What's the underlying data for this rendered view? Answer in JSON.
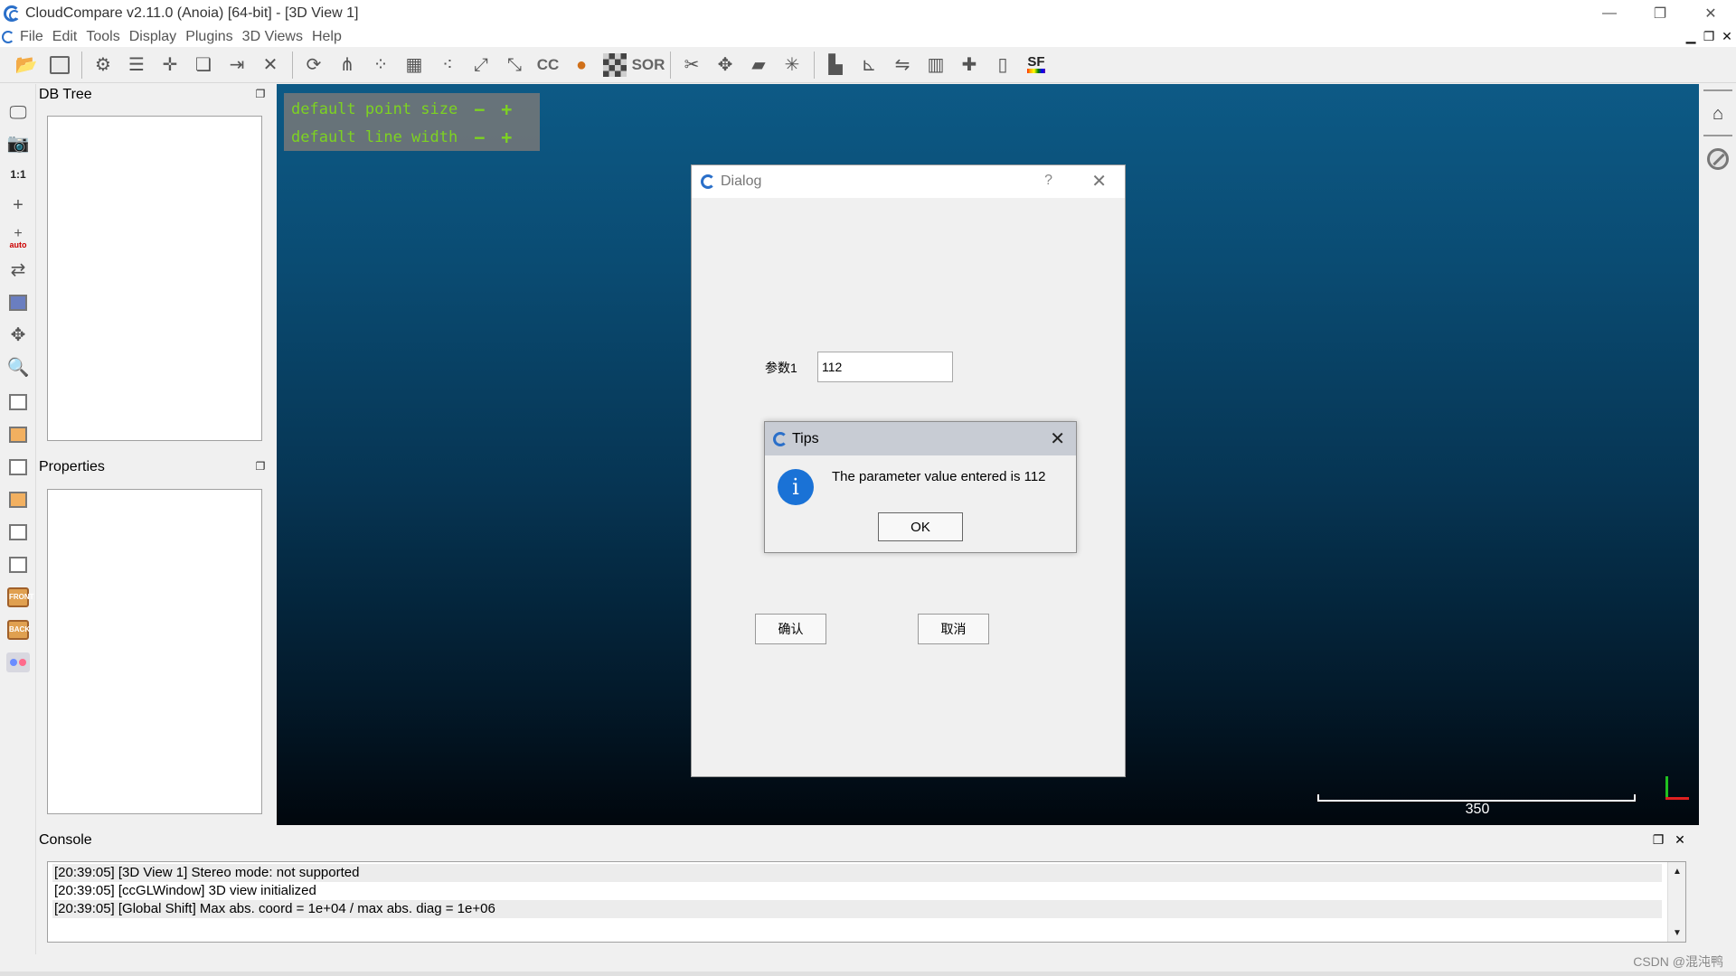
{
  "window": {
    "title": "CloudCompare v2.11.0 (Anoia) [64-bit] - [3D View 1]",
    "minimize": "—",
    "restore": "❐",
    "close": "✕"
  },
  "menu": {
    "items": [
      "File",
      "Edit",
      "Tools",
      "Display",
      "Plugins",
      "3D Views",
      "Help"
    ]
  },
  "toolbar": {
    "sor_label": "SOR",
    "sf_label": "SF",
    "cc_label": "CC"
  },
  "left_toolbar": {
    "one_to_one": "1:1",
    "auto": "auto",
    "front": "FRONT",
    "back": "BACK"
  },
  "panels": {
    "db_tree": "DB Tree",
    "properties": "Properties",
    "console": "Console"
  },
  "hud": {
    "point_size_label": "default point size",
    "line_width_label": "default line width",
    "minus": "−",
    "plus": "+"
  },
  "view": {
    "scale_value": "350"
  },
  "dialog": {
    "title": "Dialog",
    "help": "?",
    "close": "✕",
    "param_label": "参数1",
    "param_value": "112",
    "confirm_label": "确认",
    "cancel_label": "取消"
  },
  "tips": {
    "title": "Tips",
    "close": "✕",
    "icon": "i",
    "message": "The parameter value entered is 112",
    "ok_label": "OK"
  },
  "console": {
    "lines": [
      "[20:39:05] [3D View 1] Stereo mode: not supported",
      "[20:39:05] [ccGLWindow] 3D view initialized",
      "[20:39:05] [Global Shift] Max abs. coord = 1e+04 / max abs. diag = 1e+06"
    ]
  },
  "watermark": "CSDN @混沌鸭",
  "colors": {
    "hud_text": "#7dd321",
    "view_top": "#0d5a86",
    "view_bottom": "#01070d",
    "info_icon": "#1a72d6",
    "axis_x": "#e02020",
    "axis_y": "#20c020"
  }
}
